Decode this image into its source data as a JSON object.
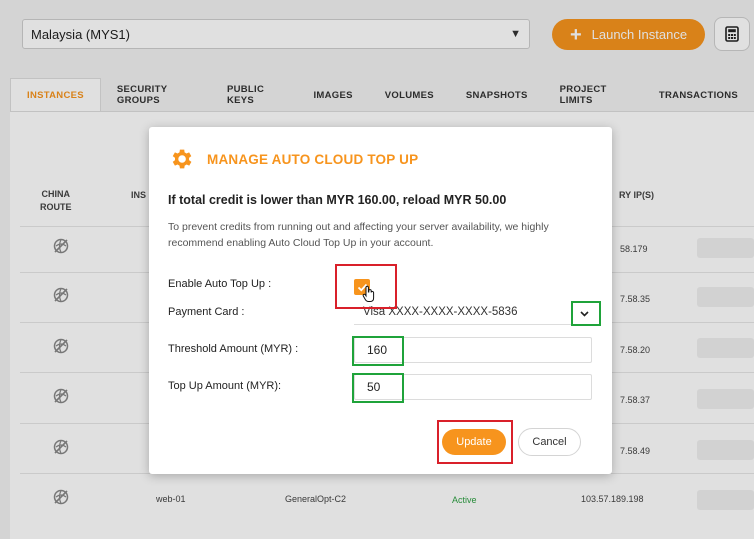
{
  "header": {
    "region_value": "Malaysia (MYS1)",
    "launch_label": "Launch Instance"
  },
  "tabs": [
    {
      "label": "INSTANCES",
      "active": true
    },
    {
      "label": "SECURITY GROUPS"
    },
    {
      "label": "PUBLIC KEYS"
    },
    {
      "label": "IMAGES"
    },
    {
      "label": "VOLUMES"
    },
    {
      "label": "SNAPSHOTS"
    },
    {
      "label": "PROJECT LIMITS"
    },
    {
      "label": "TRANSACTIONS"
    }
  ],
  "table": {
    "col_china_route_line1": "CHINA",
    "col_china_route_line2": "ROUTE",
    "col_instance_partial": "INS",
    "col_ip_partial": "RY IP(S)",
    "rows": [
      {
        "ip": "58.179"
      },
      {
        "ip": "7.58.35"
      },
      {
        "ip": "7.58.20"
      },
      {
        "ip": "7.58.37"
      },
      {
        "ip": "7.58.49"
      },
      {
        "name": "web-01",
        "flavor": "GeneralOpt-C2",
        "status": "Active",
        "ip": "103.57.189.198"
      }
    ]
  },
  "modal": {
    "title": "MANAGE AUTO CLOUD TOP UP",
    "headline": "If total credit is lower than MYR 160.00, reload MYR 50.00",
    "description": "To prevent credits from running out and affecting your server availability, we highly recommend enabling Auto Cloud Top Up in your account.",
    "enable_label": "Enable Auto Top Up :",
    "payment_label": "Payment Card :",
    "payment_value": "Visa XXXX-XXXX-XXXX-5836",
    "threshold_label": "Threshold Amount (MYR) :",
    "threshold_value": "160",
    "topup_label": "Top Up Amount (MYR):",
    "topup_value": "50",
    "update_label": "Update",
    "cancel_label": "Cancel"
  },
  "colors": {
    "accent": "#f7941d",
    "annotation_red": "#d9202a",
    "annotation_green": "#1fa33a",
    "status_active": "#2ea043"
  }
}
